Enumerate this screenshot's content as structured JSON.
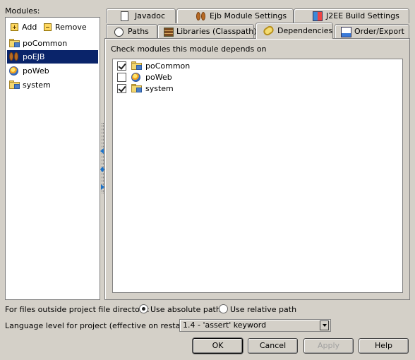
{
  "modules_panel": {
    "label": "Modules:",
    "add_label": "Add",
    "remove_label": "Remove",
    "items": [
      {
        "name": "poCommon",
        "icon": "folder-module-icon",
        "selected": false
      },
      {
        "name": "poEJB",
        "icon": "ejb-beans-icon",
        "selected": true
      },
      {
        "name": "poWeb",
        "icon": "web-globe-icon",
        "selected": false
      },
      {
        "name": "system",
        "icon": "folder-module-icon",
        "selected": false
      }
    ]
  },
  "tabs": {
    "row1": [
      {
        "label": "Javadoc",
        "icon": "javadoc-icon"
      },
      {
        "label": "Ejb Module Settings",
        "icon": "ejb-beans-icon"
      },
      {
        "label": "J2EE Build Settings",
        "icon": "build-settings-icon"
      }
    ],
    "row2": [
      {
        "label": "Paths",
        "icon": "paths-icon"
      },
      {
        "label": "Libraries (Classpath)",
        "icon": "libraries-icon"
      },
      {
        "label": "Dependencies",
        "icon": "dependencies-icon",
        "active": true
      },
      {
        "label": "Order/Export",
        "icon": "order-export-icon"
      }
    ]
  },
  "dependencies": {
    "caption": "Check modules this module depends on",
    "items": [
      {
        "name": "poCommon",
        "checked": true,
        "icon": "folder-module-icon"
      },
      {
        "name": "poWeb",
        "checked": false,
        "icon": "web-globe-icon"
      },
      {
        "name": "system",
        "checked": true,
        "icon": "folder-module-icon"
      }
    ]
  },
  "outside_files": {
    "label": "For files outside project file directory:",
    "options": [
      {
        "label": "Use absolute path",
        "selected": true
      },
      {
        "label": "Use relative path",
        "selected": false
      }
    ]
  },
  "language_level": {
    "label": "Language level for project (effective on restart):",
    "value": "1.4 - 'assert' keyword"
  },
  "buttons": {
    "ok": "OK",
    "cancel": "Cancel",
    "apply": "Apply",
    "help": "Help"
  },
  "colors": {
    "window_bg": "#d4d0c8",
    "selection": "#0a246a",
    "splitter_arrows": "#1c72c8"
  }
}
